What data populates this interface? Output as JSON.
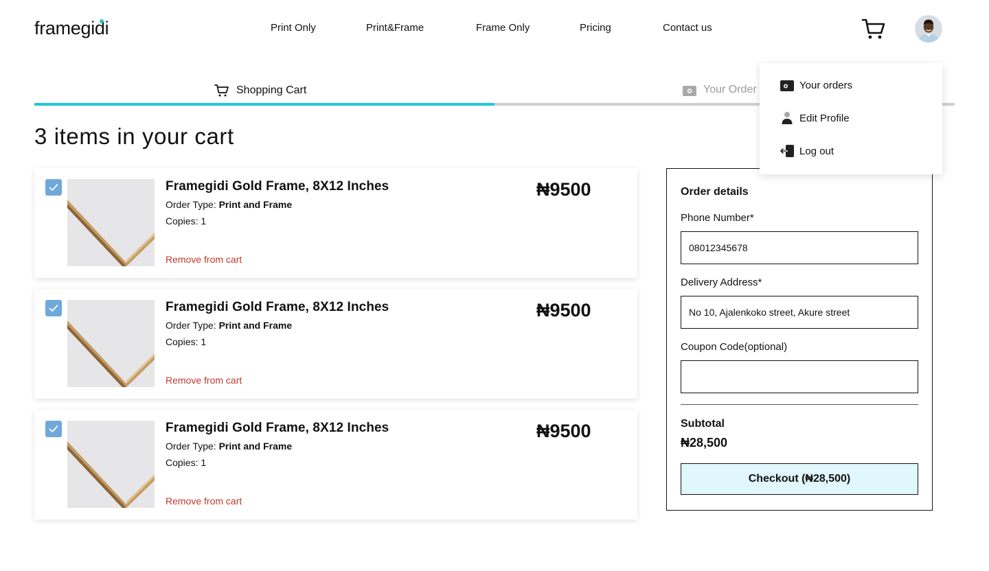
{
  "brand": {
    "logo_text": "framegidi",
    "accent_color": "#1ec8d8"
  },
  "nav": {
    "items": [
      {
        "label": "Print Only"
      },
      {
        "label": "Print&Frame"
      },
      {
        "label": "Frame Only"
      },
      {
        "label": "Pricing"
      },
      {
        "label": "Contact us"
      }
    ],
    "cart_icon": "cart-icon",
    "avatar_icon": "user-avatar"
  },
  "steps": {
    "items": [
      {
        "label": "Shopping Cart",
        "icon": "cart-icon",
        "active": true
      },
      {
        "label": "Your Order",
        "icon": "wallet-icon",
        "active": false
      }
    ],
    "progress": 0.5
  },
  "cart": {
    "title": "3 items in your cart",
    "items": [
      {
        "name": "Framegidi Gold Frame, 8X12 Inches",
        "order_type_label": "Order Type:",
        "order_type": "Print and Frame",
        "copies": "Copies: 1",
        "remove_label": "Remove from cart",
        "price": "₦9500",
        "checked": true
      },
      {
        "name": "Framegidi Gold Frame, 8X12 Inches",
        "order_type_label": "Order Type:",
        "order_type": "Print and Frame",
        "copies": "Copies: 1",
        "remove_label": "Remove from cart",
        "price": "₦9500",
        "checked": true
      },
      {
        "name": "Framegidi Gold Frame, 8X12 Inches",
        "order_type_label": "Order Type:",
        "order_type": "Print and Frame",
        "copies": "Copies: 1",
        "remove_label": "Remove from cart",
        "price": "₦9500",
        "checked": true
      }
    ]
  },
  "order_details": {
    "title": "Order details",
    "phone_label": "Phone Number*",
    "phone_value": "08012345678",
    "address_label": "Delivery Address*",
    "address_value": "No 10, Ajalenkoko street, Akure street",
    "coupon_label": "Coupon Code(optional)",
    "coupon_value": "",
    "subtotal_label": "Subtotal",
    "subtotal_value": "₦28,500",
    "checkout_label": "Checkout (₦28,500)"
  },
  "user_menu": {
    "items": [
      {
        "label": "Your orders",
        "icon": "wallet-icon"
      },
      {
        "label": "Edit Profile",
        "icon": "user-icon"
      },
      {
        "label": "Log out",
        "icon": "logout-icon"
      }
    ]
  }
}
